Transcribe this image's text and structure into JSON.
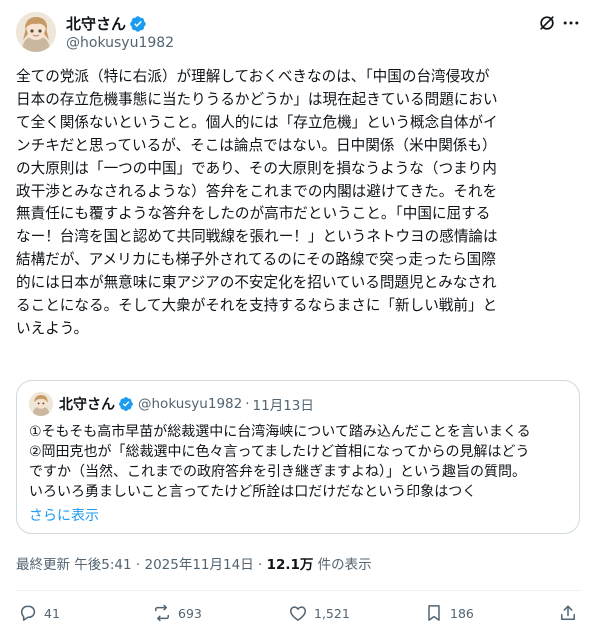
{
  "author": {
    "display_name": "北守さん",
    "handle": "@hokusyu1982",
    "verified": true,
    "verified_color": "#1d9bf0"
  },
  "tweet": {
    "lines": [
      "全ての党派（特に右派）が理解しておくべきなのは、「中国の台湾侵攻が",
      "日本の存立危機事態に当たりうるかどうか」は現在起きている問題におい",
      "て全く関係ないということ。個人的には「存立危機」という概念自体がイ",
      "ンチキだと思っているが、そこは論点ではない。日中関係（米中関係も）",
      "の大原則は「一つの中国」であり、その大原則を損なうような（つまり内",
      "政干渉とみなされるような）答弁をこれまでの内閣は避けてきた。それを",
      "無責任にも覆すような答弁をしたのが高市だということ。「中国に屈する",
      "なー！台湾を国と認めて共同戦線を張れー！」というネトウヨの感情論は",
      "結構だが、アメリカにも梯子外されてるのにその路線で突っ走ったら国際",
      "的には日本が無意味に東アジアの不安定化を招いている問題児とみなされ",
      "ることになる。そして大衆がそれを支持するならまさに「新しい戦前」と",
      "いえよう。"
    ]
  },
  "quote": {
    "display_name": "北守さん",
    "handle": "@hokusyu1982",
    "separator": "·",
    "date": "11月13日",
    "lines": [
      "①そもそも高市早苗が総裁選中に台湾海峡について踏み込んだことを言いまくる",
      "②岡田克也が「総裁選中に色々言ってましたけど首相になってからの見解はどう",
      "ですか（当然、これまでの政府答弁を引き継ぎますよね）」という趣旨の質問。",
      "いろいろ勇ましいこと言ってたけど所詮は口だけだなという印象はつく"
    ],
    "show_more": "さらに表示"
  },
  "meta": {
    "timestamp": "最終更新 午後5:41 · 2025年11月14日 · ",
    "views_count": "12.1万",
    "views_label": " 件の表示"
  },
  "actions": {
    "replies": "41",
    "reposts": "693",
    "likes": "1,521",
    "bookmarks": "186"
  },
  "icons": {
    "grok": "grok-icon",
    "more": "more-icon",
    "reply": "reply-icon",
    "repost": "repost-icon",
    "like": "like-icon",
    "bookmark": "bookmark-icon",
    "share": "share-icon"
  },
  "colors": {
    "text": "#0f1419",
    "secondary": "#536471",
    "link": "#1d9bf0",
    "border": "#cfd9de"
  }
}
